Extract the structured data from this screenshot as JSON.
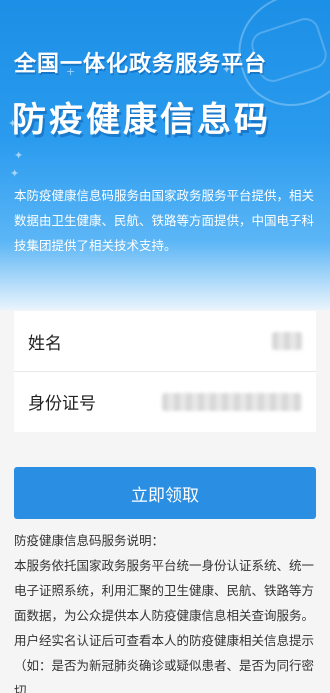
{
  "header": {
    "title_line1": "全国一体化政务服务平台",
    "title_line2": "防疫健康信息码",
    "intro": "本防疫健康信息码服务由国家政务服务平台提供，相关数据由卫生健康、民航、铁路等方面提供，中国电子科技集团提供了相关技术支持。"
  },
  "form": {
    "name_label": "姓名",
    "id_label": "身份证号"
  },
  "action": {
    "submit_label": "立即领取"
  },
  "description": {
    "heading": "防疫健康信息码服务说明：",
    "paragraph1": "本服务依托国家政务服务平台统一身份认证系统、统一电子证照系统，利用汇聚的卫生健康、民航、铁路等方面数据，为公众提供本人防疫健康信息相关查询服务。",
    "paragraph2": "用户经实名认证后可查看本人的防疫健康相关信息提示（如：是否为新冠肺炎确诊或疑似患者、是否为同行密切"
  },
  "colors": {
    "primary": "#2a8fe3",
    "header_blue": "#1c8fe6"
  },
  "icons": [
    "mask-illustration",
    "sparkle-icon"
  ]
}
